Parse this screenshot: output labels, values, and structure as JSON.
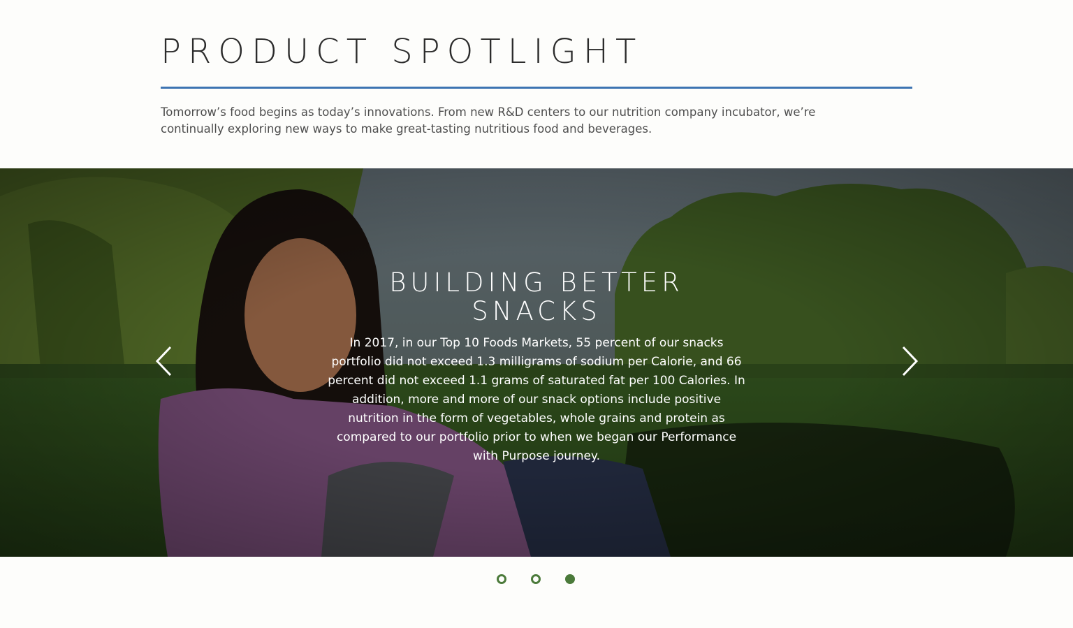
{
  "section": {
    "title": "PRODUCT SPOTLIGHT",
    "intro": "Tomorrow’s food begins as today’s innovations. From new R&D centers to our nutrition company incubator, we’re continually exploring new ways to make great-tasting nutritious food and beverages."
  },
  "carousel": {
    "slide": {
      "title": "BUILDING BETTER SNACKS",
      "body": "In 2017, in our Top 10 Foods Markets, 55 percent of our snacks portfolio did not exceed 1.3 milligrams of sodium per Calorie, and 66 percent did not exceed 1.1 grams of saturated fat per 100 Calories. In addition, more and more of our snack options include positive nutrition in the form of vegetables, whole grains and protein as compared to our portfolio prior to when we began our Performance with Purpose journey."
    },
    "prev_icon": "chevron-left-icon",
    "next_icon": "chevron-right-icon",
    "slide_count": 3,
    "active_slide": 3
  },
  "colors": {
    "accent_rule": "#3d74b2",
    "dot_green": "#4b7a3a",
    "page_bg": "#fdfdfb"
  }
}
